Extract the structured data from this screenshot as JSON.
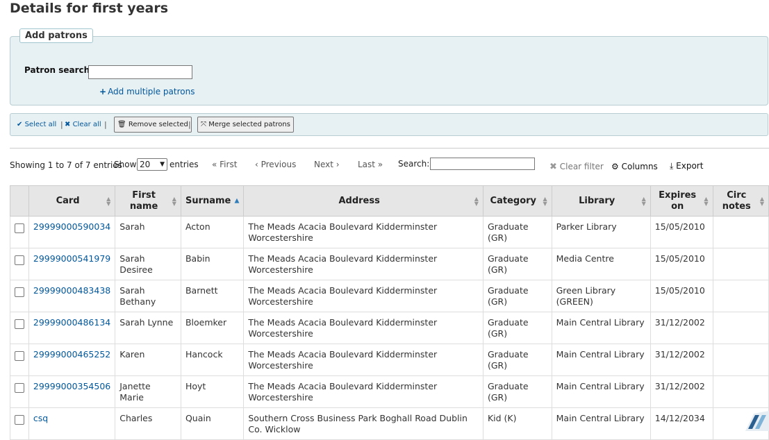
{
  "page_title": "Details for first years",
  "add_patrons": {
    "legend": "Add patrons",
    "patron_search_label": "Patron search:",
    "patron_search_value": "",
    "add_multiple_label": "Add multiple patrons"
  },
  "toolbar": {
    "select_all": "Select all",
    "clear_all": "Clear all",
    "remove_selected": "Remove selected",
    "merge_selected": "Merge selected patrons"
  },
  "table_controls": {
    "info": "Showing 1 to 7 of 7 entries",
    "show_label": "Show",
    "page_size": "20",
    "entries_label": "entries",
    "first": "« First",
    "previous": "‹ Previous",
    "next": "Next ›",
    "last": "Last »",
    "search_label": "Search:",
    "search_value": "",
    "clear_filter": "Clear filter",
    "columns": "Columns",
    "export": "Export"
  },
  "columns": [
    "Card",
    "First name",
    "Surname",
    "Address",
    "Category",
    "Library",
    "Expires on",
    "Circ notes"
  ],
  "sorted_column": "Surname",
  "rows": [
    {
      "card": "29999000590034",
      "first_name": "Sarah",
      "surname": "Acton",
      "address": "The Meads Acacia Boulevard Kidderminster Worcestershire",
      "category": "Graduate (GR)",
      "library": "Parker Library",
      "expires": "15/05/2010",
      "circ_notes": ""
    },
    {
      "card": "29999000541979",
      "first_name": "Sarah Desiree",
      "surname": "Babin",
      "address": "The Meads Acacia Boulevard Kidderminster Worcestershire",
      "category": "Graduate (GR)",
      "library": "Media Centre",
      "expires": "15/05/2010",
      "circ_notes": ""
    },
    {
      "card": "29999000483438",
      "first_name": "Sarah Bethany",
      "surname": "Barnett",
      "address": "The Meads Acacia Boulevard Kidderminster Worcestershire",
      "category": "Graduate (GR)",
      "library": "Green Library (GREEN)",
      "expires": "15/05/2010",
      "circ_notes": ""
    },
    {
      "card": "29999000486134",
      "first_name": "Sarah Lynne",
      "surname": "Bloemker",
      "address": "The Meads Acacia Boulevard Kidderminster Worcestershire",
      "category": "Graduate (GR)",
      "library": "Main Central Library",
      "expires": "31/12/2002",
      "circ_notes": ""
    },
    {
      "card": "29999000465252",
      "first_name": "Karen",
      "surname": "Hancock",
      "address": "The Meads Acacia Boulevard Kidderminster Worcestershire",
      "category": "Graduate (GR)",
      "library": "Main Central Library",
      "expires": "31/12/2002",
      "circ_notes": ""
    },
    {
      "card": "29999000354506",
      "first_name": "Janette Marie",
      "surname": "Hoyt",
      "address": "The Meads Acacia Boulevard Kidderminster Worcestershire",
      "category": "Graduate (GR)",
      "library": "Main Central Library",
      "expires": "31/12/2002",
      "circ_notes": ""
    },
    {
      "card": "csq",
      "first_name": "Charles",
      "surname": "Quain",
      "address": "Southern Cross Business Park Boghall Road Dublin Co. Wicklow",
      "category": "Kid (K)",
      "library": "Main Central Library",
      "expires": "14/12/2034",
      "circ_notes": ""
    }
  ],
  "icons": {
    "check": "check-icon",
    "x": "x-icon",
    "trash": "trash-icon",
    "merge": "merge-icon",
    "plus": "plus-icon",
    "gear": "gear-icon",
    "download": "download-icon"
  },
  "colors": {
    "link": "#00579c",
    "panel_bg": "#e7f0f2",
    "header_bg": "#e6e6e6",
    "sort_active": "#2f7db8"
  }
}
